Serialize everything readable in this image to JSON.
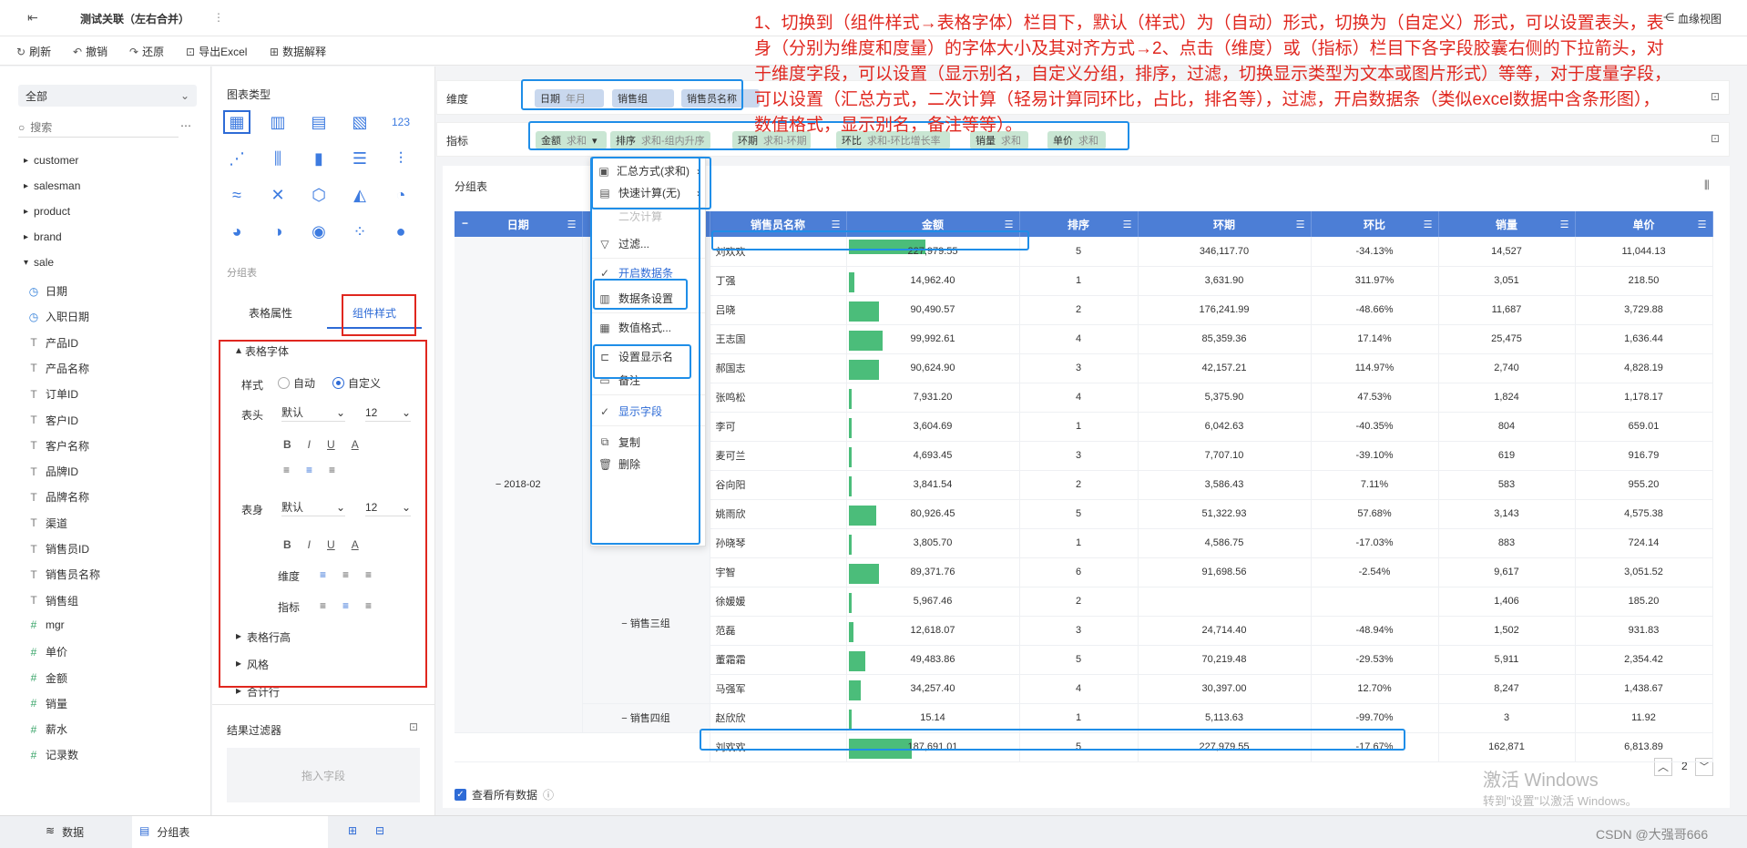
{
  "top": {
    "title": "测试关联（左右合并）",
    "more": "⋮",
    "kinship": "血缘视图"
  },
  "toolbar": {
    "items": [
      "刷新",
      "撤销",
      "还原",
      "导出Excel",
      "数据解释"
    ]
  },
  "left": {
    "dataset": "全部",
    "search_placeholder": "搜索",
    "tables": [
      "customer",
      "salesman",
      "product",
      "brand",
      "sale"
    ],
    "fields": [
      {
        "icon": "◷",
        "type": "date",
        "label": "日期"
      },
      {
        "icon": "◷",
        "type": "date",
        "label": "入职日期"
      },
      {
        "icon": "T",
        "type": "txt",
        "label": "产品ID"
      },
      {
        "icon": "T",
        "type": "txt",
        "label": "产品名称"
      },
      {
        "icon": "T",
        "type": "txt",
        "label": "订单ID"
      },
      {
        "icon": "T",
        "type": "txt",
        "label": "客户ID"
      },
      {
        "icon": "T",
        "type": "txt",
        "label": "客户名称"
      },
      {
        "icon": "T",
        "type": "txt",
        "label": "品牌ID"
      },
      {
        "icon": "T",
        "type": "txt",
        "label": "品牌名称"
      },
      {
        "icon": "T",
        "type": "txt",
        "label": "渠道"
      },
      {
        "icon": "T",
        "type": "txt",
        "label": "销售员ID"
      },
      {
        "icon": "T",
        "type": "txt",
        "label": "销售员名称"
      },
      {
        "icon": "T",
        "type": "txt",
        "label": "销售组"
      },
      {
        "icon": "#",
        "type": "num",
        "label": "mgr"
      },
      {
        "icon": "#",
        "type": "num",
        "label": "单价"
      },
      {
        "icon": "#",
        "type": "num",
        "label": "金额"
      },
      {
        "icon": "#",
        "type": "num",
        "label": "销量"
      },
      {
        "icon": "#",
        "type": "num",
        "label": "薪水"
      },
      {
        "icon": "#",
        "type": "num",
        "label": "记录数"
      }
    ]
  },
  "mid": {
    "chart_type_label": "图表类型",
    "group_label": "分组表",
    "tab_table_attr": "表格属性",
    "tab_component_style": "组件样式",
    "section_font": "表格字体",
    "style_label": "样式",
    "radio_auto": "自动",
    "radio_custom": "自定义",
    "header_label": "表头",
    "body_label": "表身",
    "font_default": "默认",
    "font_size": "12",
    "dim_label": "维度",
    "metric_label": "指标",
    "section_row_height": "表格行高",
    "section_style": "风格",
    "section_total": "合计行",
    "filter_label": "结果过滤器",
    "drop_hint": "拖入字段"
  },
  "dims": {
    "label": "维度",
    "pills": [
      {
        "name": "日期",
        "sub": "年月"
      },
      {
        "name": "销售组",
        "sub": ""
      },
      {
        "name": "销售员名称",
        "sub": ""
      }
    ]
  },
  "metrics": {
    "label": "指标",
    "pills": [
      {
        "name": "金额",
        "sub": "求和"
      },
      {
        "name": "排序",
        "sub": "求和-组内升序"
      },
      {
        "name": "环期",
        "sub": "求和-环期"
      },
      {
        "name": "环比",
        "sub": "求和-环比增长率"
      },
      {
        "name": "销量",
        "sub": "求和"
      },
      {
        "name": "单价",
        "sub": "求和"
      }
    ]
  },
  "menu": {
    "items": [
      {
        "icon": "▣",
        "label": "汇总方式(求和)",
        "arrow": "›",
        "state": ""
      },
      {
        "icon": "▤",
        "label": "快速计算(无)",
        "arrow": "›",
        "state": ""
      },
      {
        "icon": "",
        "label": "二次计算",
        "arrow": "",
        "state": "dis"
      },
      {
        "icon": "▽",
        "label": "过滤...",
        "arrow": "",
        "state": ""
      },
      {
        "icon": "✓",
        "label": "开启数据条",
        "arrow": "",
        "state": "blue"
      },
      {
        "icon": "▥",
        "label": "数据条设置",
        "arrow": "",
        "state": ""
      },
      {
        "icon": "▦",
        "label": "数值格式...",
        "arrow": "",
        "state": ""
      },
      {
        "icon": "⊏",
        "label": "设置显示名",
        "arrow": "",
        "state": ""
      },
      {
        "icon": "▭",
        "label": "备注",
        "arrow": "",
        "state": ""
      },
      {
        "icon": "✓",
        "label": "显示字段",
        "arrow": "",
        "state": "blue"
      },
      {
        "icon": "⧉",
        "label": "复制",
        "arrow": "",
        "state": ""
      },
      {
        "icon": "🗑",
        "label": "删除",
        "arrow": "",
        "state": ""
      }
    ]
  },
  "table": {
    "title": "分组表",
    "headers": [
      "日期",
      "销售组",
      "销售员名称",
      "金额",
      "排序",
      "环期",
      "环比",
      "销量",
      "单价"
    ],
    "date_group": "2018-02",
    "group3": "销售三组",
    "group4": "销售四组",
    "rows": [
      {
        "name": "刘欢欢",
        "amt": "227,979.55",
        "bar": 1.0,
        "rank": "5",
        "prev": "346,117.70",
        "ratio": "-34.13%",
        "qty": "14,527",
        "price": "11,044.13"
      },
      {
        "name": "丁强",
        "amt": "14,962.40",
        "bar": 0.066,
        "rank": "1",
        "prev": "3,631.90",
        "ratio": "311.97%",
        "qty": "3,051",
        "price": "218.50"
      },
      {
        "name": "吕晓",
        "amt": "90,490.57",
        "bar": 0.397,
        "rank": "2",
        "prev": "176,241.99",
        "ratio": "-48.66%",
        "qty": "11,687",
        "price": "3,729.88"
      },
      {
        "name": "王志国",
        "amt": "99,992.61",
        "bar": 0.439,
        "rank": "4",
        "prev": "85,359.36",
        "ratio": "17.14%",
        "qty": "25,475",
        "price": "1,636.44"
      },
      {
        "name": "郝国志",
        "amt": "90,624.90",
        "bar": 0.398,
        "rank": "3",
        "prev": "42,157.21",
        "ratio": "114.97%",
        "qty": "2,740",
        "price": "4,828.19"
      },
      {
        "name": "张鸣松",
        "amt": "7,931.20",
        "bar": 0.035,
        "rank": "4",
        "prev": "5,375.90",
        "ratio": "47.53%",
        "qty": "1,824",
        "price": "1,178.17"
      },
      {
        "name": "李可",
        "amt": "3,604.69",
        "bar": 0.016,
        "rank": "1",
        "prev": "6,042.63",
        "ratio": "-40.35%",
        "qty": "804",
        "price": "659.01"
      },
      {
        "name": "麦可兰",
        "amt": "4,693.45",
        "bar": 0.021,
        "rank": "3",
        "prev": "7,707.10",
        "ratio": "-39.10%",
        "qty": "619",
        "price": "916.79"
      },
      {
        "name": "谷向阳",
        "amt": "3,841.54",
        "bar": 0.017,
        "rank": "2",
        "prev": "3,586.43",
        "ratio": "7.11%",
        "qty": "583",
        "price": "955.20"
      },
      {
        "name": "姚雨欣",
        "amt": "80,926.45",
        "bar": 0.355,
        "rank": "5",
        "prev": "51,322.93",
        "ratio": "57.68%",
        "qty": "3,143",
        "price": "4,575.38"
      },
      {
        "name": "孙晓琴",
        "amt": "3,805.70",
        "bar": 0.017,
        "rank": "1",
        "prev": "4,586.75",
        "ratio": "-17.03%",
        "qty": "883",
        "price": "724.14"
      },
      {
        "name": "宇智",
        "amt": "89,371.76",
        "bar": 0.392,
        "rank": "6",
        "prev": "91,698.56",
        "ratio": "-2.54%",
        "qty": "9,617",
        "price": "3,051.52"
      },
      {
        "name": "徐媛媛",
        "amt": "5,967.46",
        "bar": 0.026,
        "rank": "2",
        "prev": "",
        "ratio": "",
        "qty": "1,406",
        "price": "185.20"
      },
      {
        "name": "范磊",
        "amt": "12,618.07",
        "bar": 0.055,
        "rank": "3",
        "prev": "24,714.40",
        "ratio": "-48.94%",
        "qty": "1,502",
        "price": "931.83"
      },
      {
        "name": "董霜霜",
        "amt": "49,483.86",
        "bar": 0.217,
        "rank": "5",
        "prev": "70,219.48",
        "ratio": "-29.53%",
        "qty": "5,911",
        "price": "2,354.42"
      },
      {
        "name": "马强军",
        "amt": "34,257.40",
        "bar": 0.15,
        "rank": "4",
        "prev": "30,397.00",
        "ratio": "12.70%",
        "qty": "8,247",
        "price": "1,438.67"
      },
      {
        "name": "赵欣欣",
        "amt": "15.14",
        "bar": 0.0,
        "rank": "1",
        "prev": "5,113.63",
        "ratio": "-99.70%",
        "qty": "3",
        "price": "11.92"
      },
      {
        "name": "刘欢欢",
        "amt": "187,691.01",
        "bar": 0.823,
        "rank": "5",
        "prev": "227,979.55",
        "ratio": "-17.67%",
        "qty": "162,871",
        "price": "6,813.89"
      }
    ],
    "view_all": "查看所有数据",
    "page": "2"
  },
  "bottom": {
    "tab_data": "数据",
    "tab_group": "分组表"
  },
  "annotation": "1、切换到（组件样式→表格字体）栏目下，默认（样式）为（自动）形式，切换为（自定义）形式，可以设置表头，表身（分别为维度和度量）的字体大小及其对齐方式→2、点击（维度）或（指标）栏目下各字段胶囊右侧的下拉箭头，对于维度字段，可以设置（显示别名，自定义分组，排序，过滤，切换显示类型为文本或图片形式）等等，对于度量字段，可以设置（汇总方式，二次计算（轻易计算同环比，占比，排名等），过滤，开启数据条（类似excel数据中含条形图），数值格式，显示别名，备注等等）。",
  "watermark": {
    "line1": "激活 Windows",
    "line2": "转到\"设置\"以激活 Windows。"
  },
  "credit": "CSDN @大强哥666",
  "colors": {
    "accent": "#4c7ed6",
    "bar": "#4bbd7a",
    "annotation": "#e0271f",
    "highlight": "#1f8ee8"
  }
}
